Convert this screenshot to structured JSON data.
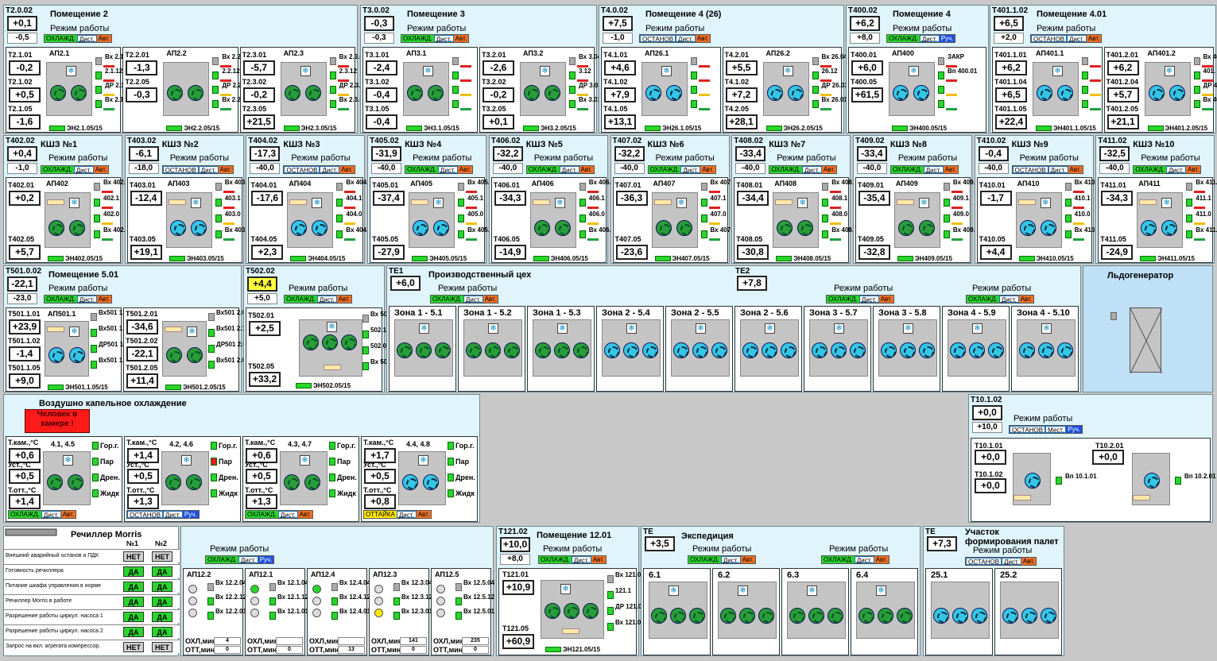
{
  "rooms": [
    {
      "id": "T2.0.02",
      "title": "Помещение 2",
      "v": "+0,1",
      "set": "-0,5",
      "mode": "Режим работы",
      "status": [
        "ОХЛАЖД.",
        "Дист.",
        "Авт."
      ],
      "aps": [
        {
          "name": "АП2.1",
          "s": [
            [
              "T2.1.01",
              "-0,2"
            ],
            [
              "T2.1.02",
              "+0,5"
            ],
            [
              "T2.1.05",
              "-1,6"
            ]
          ],
          "eh": "ЭН2.1.05/15",
          "v": [
            "Вх 2.1.04",
            "2.1.12",
            "ДР 2.1.03",
            "Вх 2.1.01"
          ]
        },
        {
          "name": "АП2.2",
          "s": [
            [
              "T2.2.01",
              "-1,3"
            ],
            [
              "T2.2.05",
              "-0,3"
            ]
          ],
          "eh": "ЭН2.2.05/15",
          "v": [
            "Вх 2.2.04",
            "2.2.12",
            "ДР 2.2.03",
            "Вх 2.2.01"
          ]
        },
        {
          "name": "АП2.3",
          "s": [
            [
              "T2.3.01",
              "-5,7"
            ],
            [
              "T2.3.02",
              "-0,2"
            ],
            [
              "T2.3.05",
              "+21,5"
            ]
          ],
          "eh": "ЭН2.3.05/15",
          "v": [
            "Вх 2.3.04",
            "2.3.12",
            "ДР 2.3.03",
            "Вх 2.3.01"
          ]
        }
      ]
    },
    {
      "id": "T3.0.02",
      "title": "Помещение 3",
      "v": "-0,3",
      "set": "-0,3",
      "mode": "Режим работы",
      "status": [
        "ОХЛАЖД.",
        "Дист.",
        "Авт."
      ],
      "aps": [
        {
          "name": "АП3.1",
          "s": [
            [
              "T3.1.01",
              "-2,4"
            ],
            [
              "T3.1.02",
              "-0,4"
            ],
            [
              "T3.1.05",
              "-0,4"
            ]
          ],
          "eh": "ЭН3.1.05/15",
          "v": []
        },
        {
          "name": "АП3.2",
          "s": [
            [
              "T3.2.01",
              "-2,6"
            ],
            [
              "T3.2.02",
              "-0,2"
            ],
            [
              "T3.2.05",
              "+0,1"
            ]
          ],
          "eh": "ЭН3.2.05/15",
          "v": [
            "Вх 3.04",
            "3.12",
            "ДР 3.03",
            "Вх 3.01"
          ]
        }
      ]
    },
    {
      "id": "T4.0.02",
      "title": "Помещение 4 (26)",
      "v": "+7,5",
      "set": "-1,0",
      "mode": "Режим работы",
      "status": [
        "ОСТАНОВ",
        "Дист.",
        "Авт."
      ],
      "aps": [
        {
          "name": "АП26.1",
          "s": [
            [
              "T4.1.01",
              "+4,6"
            ],
            [
              "T4.1.02",
              "+7,9"
            ],
            [
              "T4.1.05",
              "+13,1"
            ]
          ],
          "eh": "ЭН26.1.05/15",
          "v": []
        },
        {
          "name": "АП26.2",
          "s": [
            [
              "T4.2.01",
              "+5,5"
            ],
            [
              "T4.1.02",
              "+7,2"
            ],
            [
              "T4.2.05",
              "+28,1"
            ]
          ],
          "eh": "ЭН26.2.05/15",
          "v": [
            "Вх 26.04",
            "26.12",
            "ДР 26.03",
            "Вх 26.01"
          ]
        }
      ]
    },
    {
      "id": "T400.02",
      "title": "Помещение 4",
      "v": "+6,2",
      "set": "+8,0",
      "mode": "Режим работы",
      "status": [
        "ОХЛАЖД.",
        "Дист.",
        "Руч."
      ],
      "aps": [
        {
          "name": "АП400",
          "s": [
            [
              "T400.01",
              "+6,0"
            ],
            [
              "T400.05",
              "+61,5"
            ]
          ],
          "eh": "ЭН400.05/15",
          "v": [
            "ЗАКР",
            "Вп 400.01"
          ]
        }
      ]
    },
    {
      "id": "T401.1.02",
      "title": "Помещение 4.01",
      "v": "+6,5",
      "set": "+2,0",
      "mode": "Режим работы",
      "status": [
        "ОСТАНОВ",
        "Дист.",
        "Авт."
      ],
      "aps": [
        {
          "name": "АП401.1",
          "s": [
            [
              "T401.1.01",
              "+6,2"
            ],
            [
              "T401.1.04",
              "+6,5"
            ],
            [
              "T401.1.05",
              "+22,4"
            ]
          ],
          "eh": "ЭН401.1.05/15",
          "v": []
        },
        {
          "name": "АП401.2",
          "s": [
            [
              "T401.2.01",
              "+6,2"
            ],
            [
              "T401.2.04",
              "+5,7"
            ],
            [
              "T401.2.05",
              "+21,1"
            ]
          ],
          "eh": "ЭН401.2.05/15",
          "v": [
            "Вх 401.",
            "401.",
            "ДР 401.",
            "Вх 401."
          ]
        }
      ]
    }
  ],
  "kshs": [
    {
      "id": "T402.02",
      "title": "КШЗ №1",
      "v": "+0,4",
      "set": "-1,0",
      "status": [
        "ОХЛАЖД.",
        "Дист.",
        "Авт."
      ],
      "ap": "АП402",
      "s1": [
        "T402.01",
        "+0,2"
      ],
      "s5": [
        "T402.05",
        "+5,7"
      ],
      "eh": "ЭН402.05/15",
      "vv": [
        "Вх 402.0",
        "402.1",
        "402.0",
        "Вх 402.0"
      ]
    },
    {
      "id": "T403.02",
      "title": "КШЗ №2",
      "v": "-6,1",
      "set": "-18,0",
      "status": [
        "ОСТАНОВ",
        "Дист.",
        "Авт."
      ],
      "ap": "АП403",
      "s1": [
        "T403.01",
        "-12,4"
      ],
      "s5": [
        "T403.05",
        "+19,1"
      ],
      "eh": "ЭН403.05/15",
      "vv": [
        "Вх 403.0",
        "403.1",
        "403.0",
        "Вх 403.0"
      ]
    },
    {
      "id": "T404.02",
      "title": "КШЗ №3",
      "v": "-17,3",
      "set": "-40,0",
      "status": [
        "ОСТАНОВ",
        "Дист.",
        "Авт."
      ],
      "ap": "АП404",
      "s1": [
        "T404.01",
        "-17,6"
      ],
      "s5": [
        "T404.05",
        "+2,3"
      ],
      "eh": "ЭН404.05/15",
      "vv": [
        "Вх 404.0",
        "404.1",
        "404.0",
        "Вх 404.0"
      ]
    },
    {
      "id": "T405.02",
      "title": "КШЗ №4",
      "v": "-31,9",
      "set": "-40,0",
      "status": [
        "ОХЛАЖД.",
        "Дист.",
        "Авт."
      ],
      "ap": "АП405",
      "s1": [
        "T405.01",
        "-37,4"
      ],
      "s5": [
        "T405.05",
        "-27,9"
      ],
      "eh": "ЭН405.05/15",
      "vv": [
        "Вх 405.0",
        "405.1",
        "405.0",
        "Вх 405.0"
      ]
    },
    {
      "id": "T406.02",
      "title": "КШЗ №5",
      "v": "-32,2",
      "set": "-40,0",
      "status": [
        "ОХЛАЖД.",
        "Дист.",
        "Авт."
      ],
      "ap": "АП406",
      "s1": [
        "T406.01",
        "-34,3"
      ],
      "s5": [
        "T406.05",
        "-14,9"
      ],
      "eh": "ЭН406.05/15",
      "vv": [
        "Вх 406.0",
        "406.1",
        "406.0",
        "Вх 406.0"
      ]
    },
    {
      "id": "T407.02",
      "title": "КШЗ №6",
      "v": "-32,2",
      "set": "-40,0",
      "status": [
        "ОХЛАЖД.",
        "Дист.",
        "Авт."
      ],
      "ap": "АП407",
      "s1": [
        "T407.01",
        "-36,3"
      ],
      "s5": [
        "T407.05",
        "-23,6"
      ],
      "eh": "ЭН407.05/15",
      "vv": [
        "Вх 407.0",
        "407.1",
        "407.0",
        "Вх 407.0"
      ]
    },
    {
      "id": "T408.02",
      "title": "КШЗ №7",
      "v": "-33,4",
      "set": "-40,0",
      "status": [
        "ОХЛАЖД.",
        "Дист.",
        "Авт."
      ],
      "ap": "АП408",
      "s1": [
        "T408.01",
        "-34,4"
      ],
      "s5": [
        "T408.05",
        "-30,8"
      ],
      "eh": "ЭН408.05/15",
      "vv": [
        "Вх 408.0",
        "408.1",
        "408.0",
        "Вх 408.0"
      ]
    },
    {
      "id": "T409.02",
      "title": "КШЗ №8",
      "v": "-33,4",
      "set": "-40,0",
      "status": [
        "ОХЛАЖД.",
        "Дист.",
        "Авт."
      ],
      "ap": "АП409",
      "s1": [
        "T409.01",
        "-35,4"
      ],
      "s5": [
        "T409.05",
        "-32,8"
      ],
      "eh": "ЭН409.05/15",
      "vv": [
        "Вх 409.0",
        "409.1",
        "409.0",
        "Вх 409.0"
      ]
    },
    {
      "id": "T410.02",
      "title": "КШЗ №9",
      "v": "-0,4",
      "set": "-40,0",
      "status": [
        "ОСТАНОВ",
        "Дист.",
        "Авт."
      ],
      "ap": "АП410",
      "s1": [
        "T410.01",
        "-1,7"
      ],
      "s5": [
        "T410.05",
        "+4,4"
      ],
      "eh": "ЭН410.05/15",
      "vv": [
        "Вх 410.0",
        "410.1",
        "410.0",
        "Вх 410.0"
      ]
    },
    {
      "id": "T411.02",
      "title": "КШЗ №10",
      "v": "-32,5",
      "set": "-40,0",
      "status": [
        "ОХЛАЖД.",
        "Дист.",
        "Авт."
      ],
      "ap": "АП411",
      "s1": [
        "T411.01",
        "-34,3"
      ],
      "s5": [
        "T411.05",
        "-24,9"
      ],
      "eh": "ЭН411.05/15",
      "vv": [
        "Вх 411.0",
        "411.1",
        "411.0",
        "Вх 411.0"
      ]
    }
  ],
  "room5": {
    "id": "T501.0.02",
    "title": "Помещение 5.01",
    "v": "-22,1",
    "set": "-23,0",
    "mode": "Режим работы",
    "status": [
      "ОХЛАЖД.",
      "Дист.",
      "Авт."
    ],
    "ap1": {
      "name": "АП501.1",
      "s": [
        [
          "T501.1.01",
          "+23,9"
        ],
        [
          "T501.1.02",
          "-1,4"
        ],
        [
          "T501.1.05",
          "+9,0"
        ]
      ],
      "eh": "ЭН501.1.05/15",
      "v": [
        "Вх501 1.04",
        "Вх501 1.12",
        "ДР501 1.03",
        "Вх501 1.01"
      ]
    },
    "ap2": {
      "name": "",
      "s": [
        [
          "T501.2.01",
          "-34,6"
        ],
        [
          "T501.2.02",
          "-22,1"
        ],
        [
          "T501.2.05",
          "+11,4"
        ]
      ],
      "eh": "ЭН501.2.05/15",
      "v": [
        "Вх501 2.04",
        "Вх501 2.12",
        "ДР501 2.03",
        "Вх501 2.01"
      ]
    }
  },
  "t502": {
    "id": "T502.02",
    "v": "+4,4",
    "set": "+5,0",
    "mode": "Режим работы",
    "status": [
      "ОХЛАЖД.",
      "Дист.",
      "Авт."
    ],
    "s1": [
      "T502.01",
      "+2,5"
    ],
    "s5": [
      "T502.05",
      "+33,2"
    ],
    "eh": "ЭН502.05/15",
    "vv": [
      "Вх 502.0",
      "502.1",
      "502.0",
      "Вх 502.0"
    ]
  },
  "prod": {
    "title": "Производственный цех",
    "te1": "TE1",
    "v1": "+6,0",
    "te2": "TE2",
    "v2": "+7,8",
    "mode": "Режим работы",
    "status1": [
      "ОХЛАЖД.",
      "Дист.",
      "Авт."
    ],
    "status2": [
      "ОХЛАЖД.",
      "Дист.",
      "Авт."
    ],
    "status3": [
      "ОХЛАЖД.",
      "Дист.",
      "Авт."
    ],
    "zones": [
      "Зона 1 - 5.1",
      "Зона 1 - 5.2",
      "Зона 1 - 5.3",
      "Зона 2 - 5.4",
      "Зона 2 - 5.5",
      "Зона 2 - 5.6",
      "Зона 3 - 5.7",
      "Зона 3 - 5.8",
      "Зона 4 - 5.9",
      "Зона 4 - 5.10"
    ]
  },
  "ice": {
    "title": "Льдогенератор"
  },
  "drip": {
    "title": "Воздушно капельное охлаждение",
    "alarm": "Человек в камере !",
    "units": [
      {
        "name": "4.1, 4.5",
        "tk": "+0,6",
        "ust": "+0,5",
        "tott": "+1,4",
        "status": [
          "ОХЛАЖД.",
          "Дист.",
          "Авт."
        ]
      },
      {
        "name": "4.2, 4.6",
        "tk": "+1,4",
        "ust": "+0,5",
        "tott": "+1,3",
        "status": [
          "ОСТАНОВ",
          "Дист.",
          "Руч."
        ]
      },
      {
        "name": "4.3, 4.7",
        "tk": "+0,6",
        "ust": "+0,5",
        "tott": "+1,3",
        "status": [
          "ОХЛАЖД.",
          "Дист.",
          "Авт."
        ]
      },
      {
        "name": "4.4, 4.8",
        "tk": "+1,7",
        "ust": "+0,5",
        "tott": "+0,8",
        "status": [
          "ОТТАЙКА",
          "Дист.",
          "Авт."
        ]
      }
    ],
    "l_tk": "Т.кам.,°С",
    "l_ust": "Уст.,°С",
    "l_tott": "Т.отт.,°С",
    "l_gor": "Гор.г.",
    "l_par": "Пар",
    "l_dren": "Дрен.",
    "l_zhid": "Жидк"
  },
  "t10": {
    "id": "T10.1.02",
    "v": "+0,0",
    "set": "+10,0",
    "mode": "Режим работы",
    "status": [
      "ОСТАНОВ",
      "Мест.",
      "Руч."
    ],
    "s1": [
      "T10.1.01",
      "+0,0"
    ],
    "s2": [
      "T10.2.01",
      "+0,0"
    ],
    "s3": [
      "T10.1.02",
      "+0,0"
    ],
    "vp1": "Вп 10.1.01",
    "vp2": "Вп 10.2.01"
  },
  "chiller": {
    "title": "Речиллер Morris",
    "c1": "№1",
    "c2": "№2",
    "rows": [
      [
        "Внешний аварийный останов и ПДК",
        "НЕТ",
        "НЕТ"
      ],
      [
        "Готовность речиллера",
        "ДА",
        "ДА"
      ],
      [
        "Питание шкафа управления в норме",
        "ДА",
        "ДА"
      ],
      [
        "Речиллер Morris в работе",
        "ДА",
        "ДА"
      ],
      [
        "Разрешение работы циркул. насоса 1",
        "ДА",
        "ДА"
      ],
      [
        "Разрешение работы циркул. насоса 2",
        "ДА",
        "ДА"
      ],
      [
        "Запрос на вкл. агрегата компрессор.",
        "НЕТ",
        "НЕТ"
      ]
    ]
  },
  "ap12": {
    "mode": "Режим работы",
    "status": [
      "ОХЛАЖД.",
      "Дист.",
      "Руч."
    ],
    "units": [
      {
        "name": "АП12.2",
        "v": [
          "Вх 12.2.04",
          "Вх 12.2.12",
          "Вх 12.2.01"
        ],
        "ohl": "4",
        "ott": "0"
      },
      {
        "name": "АП12.1",
        "v": [
          "Вх 12.1.04",
          "Вх 12.1.12",
          "Вх 12.1.01"
        ],
        "ohl": "",
        "ott": "0"
      },
      {
        "name": "АП12.4",
        "v": [
          "Вх 12.4.04",
          "Вх 12.4.12",
          "Вх 12.4.01"
        ],
        "ohl": "",
        "ott": "13"
      },
      {
        "name": "АП12.3",
        "v": [
          "Вх 12.3.04",
          "Вх 12.3.12",
          "Вх 12.3.01"
        ],
        "ohl": "141",
        "ott": "0"
      },
      {
        "name": "АП12.5",
        "v": [
          "Вх 12.5.04",
          "Вх 12.5.12",
          "Вх 12.5.01"
        ],
        "ohl": "235",
        "ott": "0"
      }
    ],
    "ohl_label": "ОХЛ,мин:",
    "ott_label": "ОТТ,мин:"
  },
  "room12": {
    "id": "T121.02",
    "title": "Помещение 12.01",
    "v": "+10,0",
    "set": "+8,0",
    "mode": "Режим работы",
    "status": [
      "ОХЛАЖД.",
      "Дист.",
      "Авт."
    ],
    "s1": [
      "T121.01",
      "+10,9"
    ],
    "s5": [
      "T121.05",
      "+60,9"
    ],
    "eh": "ЭН121.05/15",
    "vv": [
      "Вх 121.0",
      "121.1",
      "ДР 121.0",
      "Вх 121.0"
    ]
  },
  "exped": {
    "te": "TE",
    "title": "Экспедиция",
    "v": "+3,5",
    "mode": "Режим работы",
    "status1": [
      "ОХЛАЖД.",
      "Дист.",
      "Авт."
    ],
    "status2": [
      "ОХЛАЖД.",
      "Дист.",
      "Авт."
    ],
    "zones": [
      "6.1",
      "6.2",
      "6.3",
      "6.4"
    ]
  },
  "pallet": {
    "te": "TE",
    "title1": "Участок",
    "title2": "формирования палет",
    "v": "+7,3",
    "mode": "Режим работы",
    "status": [
      "ОСТАНОВ",
      "Дист.",
      "Авт."
    ],
    "zones": [
      "25.1",
      "25.2"
    ]
  }
}
